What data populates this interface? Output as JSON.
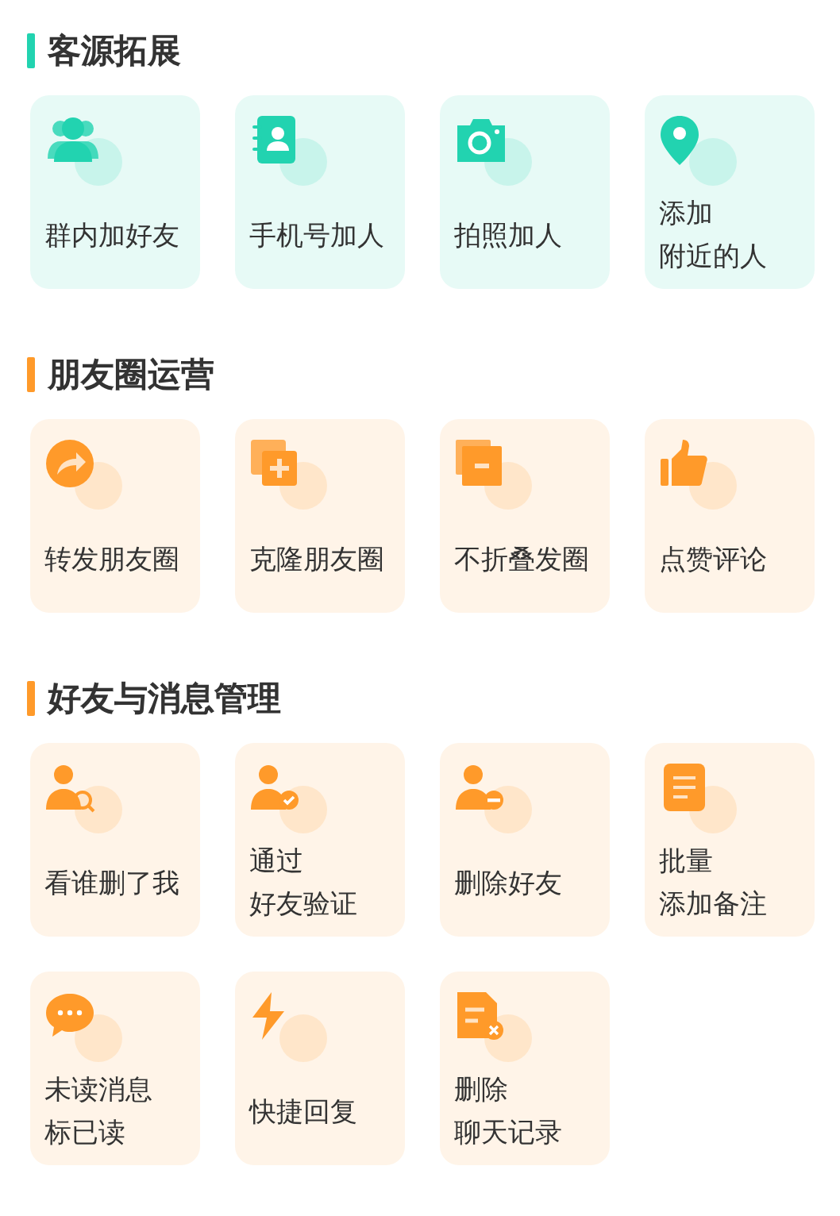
{
  "sections": [
    {
      "title": "客源拓展",
      "color": "#22d3b0",
      "tiles": [
        {
          "kind": "group",
          "lines": [
            "群内加好友"
          ]
        },
        {
          "kind": "contacts",
          "lines": [
            "手机号加人"
          ]
        },
        {
          "kind": "camera",
          "lines": [
            "拍照加人"
          ]
        },
        {
          "kind": "location",
          "lines": [
            "添加",
            "附近的人"
          ]
        }
      ]
    },
    {
      "title": "朋友圈运营",
      "color": "#ff9a2a",
      "tiles": [
        {
          "kind": "share",
          "lines": [
            "转发朋友圈"
          ]
        },
        {
          "kind": "clone",
          "lines": [
            "克隆朋友圈"
          ]
        },
        {
          "kind": "collapse",
          "lines": [
            "不折叠发圈"
          ]
        },
        {
          "kind": "like",
          "lines": [
            "点赞评论"
          ]
        }
      ]
    },
    {
      "title": "好友与消息管理",
      "color": "#ff9a2a",
      "tiles": [
        {
          "kind": "user-search",
          "lines": [
            "看谁删了我"
          ]
        },
        {
          "kind": "user-check",
          "lines": [
            "通过",
            "好友验证"
          ]
        },
        {
          "kind": "user-remove",
          "lines": [
            "删除好友"
          ]
        },
        {
          "kind": "note",
          "lines": [
            "批量",
            "添加备注"
          ]
        },
        {
          "kind": "chat",
          "lines": [
            "未读消息",
            "标已读"
          ]
        },
        {
          "kind": "bolt",
          "lines": [
            "快捷回复"
          ]
        },
        {
          "kind": "file-delete",
          "lines": [
            "删除",
            "聊天记录"
          ]
        }
      ]
    }
  ]
}
